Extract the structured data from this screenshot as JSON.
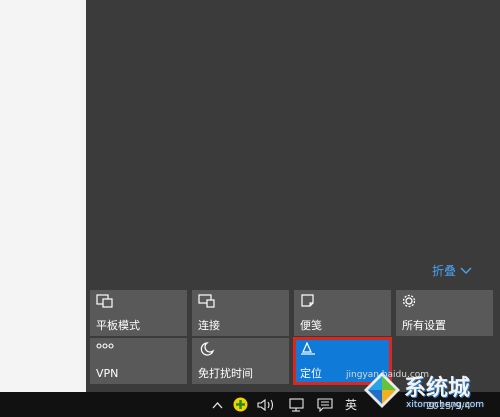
{
  "action_center": {
    "collapse_label": "折叠",
    "tiles_row1": [
      {
        "label": "平板模式",
        "icon": "tablet-mode-icon"
      },
      {
        "label": "连接",
        "icon": "connect-icon"
      },
      {
        "label": "便笺",
        "icon": "note-icon"
      },
      {
        "label": "所有设置",
        "icon": "gear-icon"
      }
    ],
    "tiles_row2": [
      {
        "label": "VPN",
        "icon": "vpn-icon"
      },
      {
        "label": "免打扰时间",
        "icon": "moon-icon"
      },
      {
        "label": "定位",
        "icon": "location-icon",
        "active": true
      }
    ]
  },
  "taskbar": {
    "language": "英",
    "date": "2015/9/4"
  },
  "watermark": {
    "brand_text": "系统城",
    "site_text": "xitongcheng.com",
    "baidu_text": "jingyan.baidu.com"
  },
  "colors": {
    "accent": "#0f7ad7",
    "highlight_border": "#d9281f",
    "tile_bg": "#595959",
    "panel_bg": "#3b3b3b",
    "taskbar_bg": "#111111",
    "collapse_text": "#4aa3f0"
  }
}
